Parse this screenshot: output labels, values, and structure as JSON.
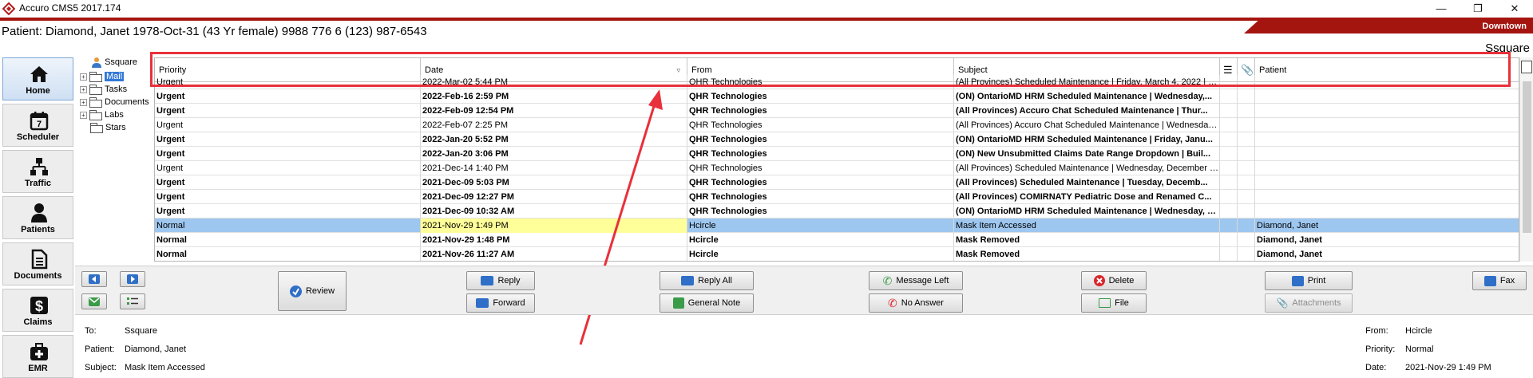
{
  "window": {
    "title": "Accuro CMS5 2017.174",
    "location": "Downtown",
    "patient_line": "Patient: Diamond, Janet 1978-Oct-31 (43 Yr female) 9988 776 6 (123) 987-6543",
    "user": "Ssquare"
  },
  "sidebar": [
    {
      "label": "Home",
      "icon": "house-icon"
    },
    {
      "label": "Scheduler",
      "icon": "calendar-icon",
      "day": "7"
    },
    {
      "label": "Traffic",
      "icon": "network-icon"
    },
    {
      "label": "Patients",
      "icon": "person-icon"
    },
    {
      "label": "Documents",
      "icon": "document-icon"
    },
    {
      "label": "Claims",
      "icon": "dollar-icon",
      "sym": "$"
    },
    {
      "label": "EMR",
      "icon": "medical-bag-icon"
    }
  ],
  "folder_tree": {
    "user": "Ssquare",
    "items": [
      "Mail",
      "Tasks",
      "Documents",
      "Labs",
      "Stars"
    ]
  },
  "grid": {
    "columns": [
      "Priority",
      "Date",
      "From",
      "Subject",
      "",
      "",
      "Patient"
    ],
    "rows": [
      {
        "priority": "Urgent",
        "date": "2022-Mar-02 5:44 PM",
        "from": "QHR Technologies",
        "subject": "(All Provinces) Scheduled Maintenance | Friday, March 4, 2022 | 1...",
        "patient": "",
        "bold": false
      },
      {
        "priority": "Urgent",
        "date": "2022-Feb-16 2:59 PM",
        "from": "QHR Technologies",
        "subject": "(ON) OntarioMD HRM Scheduled Maintenance | Wednesday,...",
        "patient": "",
        "bold": true
      },
      {
        "priority": "Urgent",
        "date": "2022-Feb-09 12:54 PM",
        "from": "QHR Technologies",
        "subject": "(All Provinces) Accuro Chat Scheduled Maintenance | Thur...",
        "patient": "",
        "bold": true
      },
      {
        "priority": "Urgent",
        "date": "2022-Feb-07 2:25 PM",
        "from": "QHR Technologies",
        "subject": "(All Provinces) Accuro Chat Scheduled Maintenance | Wednesday,...",
        "patient": "",
        "bold": false
      },
      {
        "priority": "Urgent",
        "date": "2022-Jan-20 5:52 PM",
        "from": "QHR Technologies",
        "subject": "(ON) OntarioMD HRM Scheduled Maintenance | Friday, Janu...",
        "patient": "",
        "bold": true
      },
      {
        "priority": "Urgent",
        "date": "2022-Jan-20 3:06 PM",
        "from": "QHR Technologies",
        "subject": "(ON) New Unsubmitted Claims Date Range Dropdown | Buil...",
        "patient": "",
        "bold": true
      },
      {
        "priority": "Urgent",
        "date": "2021-Dec-14 1:40 PM",
        "from": "QHR Technologies",
        "subject": "(All Provinces) Scheduled Maintenance | Wednesday, December 1...",
        "patient": "",
        "bold": false
      },
      {
        "priority": "Urgent",
        "date": "2021-Dec-09 5:03 PM",
        "from": "QHR Technologies",
        "subject": "(All Provinces) Scheduled Maintenance | Tuesday, Decemb...",
        "patient": "",
        "bold": true
      },
      {
        "priority": "Urgent",
        "date": "2021-Dec-09 12:27 PM",
        "from": "QHR Technologies",
        "subject": "(All Provinces) COMIRNATY Pediatric Dose and Renamed C...",
        "patient": "",
        "bold": true
      },
      {
        "priority": "Urgent",
        "date": "2021-Dec-09 10:32 AM",
        "from": "QHR Technologies",
        "subject": "(ON) OntarioMD HRM Scheduled Maintenance | Wednesday, Dece...",
        "patient": "",
        "bold": true
      },
      {
        "priority": "Normal",
        "date": "2021-Nov-29 1:49 PM",
        "from": "Hcircle",
        "subject": "Mask Item Accessed",
        "patient": "Diamond, Janet",
        "bold": false,
        "selected": true
      },
      {
        "priority": "Normal",
        "date": "2021-Nov-29 1:48 PM",
        "from": "Hcircle",
        "subject": "Mask Removed",
        "patient": "Diamond, Janet",
        "bold": true
      },
      {
        "priority": "Normal",
        "date": "2021-Nov-26 11:27 AM",
        "from": "Hcircle",
        "subject": "Mask Removed",
        "patient": "Diamond, Janet",
        "bold": true
      }
    ]
  },
  "actions": {
    "review": "Review",
    "reply": "Reply",
    "forward": "Forward",
    "reply_all": "Reply All",
    "general_note": "General Note",
    "message_left": "Message Left",
    "no_answer": "No Answer",
    "delete": "Delete",
    "file": "File",
    "print": "Print",
    "attachments": "Attachments",
    "fax": "Fax"
  },
  "detail": {
    "to_label": "To:",
    "to": "Ssquare",
    "patient_label": "Patient:",
    "patient": "Diamond, Janet",
    "subject_label": "Subject:",
    "subject": "Mask Item Accessed",
    "from_label": "From:",
    "from": "Hcircle",
    "priority_label": "Priority:",
    "priority": "Normal",
    "date_label": "Date:",
    "date": "2021-Nov-29 1:49 PM"
  },
  "colors": {
    "brand_red": "#a5150f",
    "annotation_red": "#e8313b",
    "selection_blue": "#9ec7f0",
    "highlight_yellow": "#ffff99"
  }
}
